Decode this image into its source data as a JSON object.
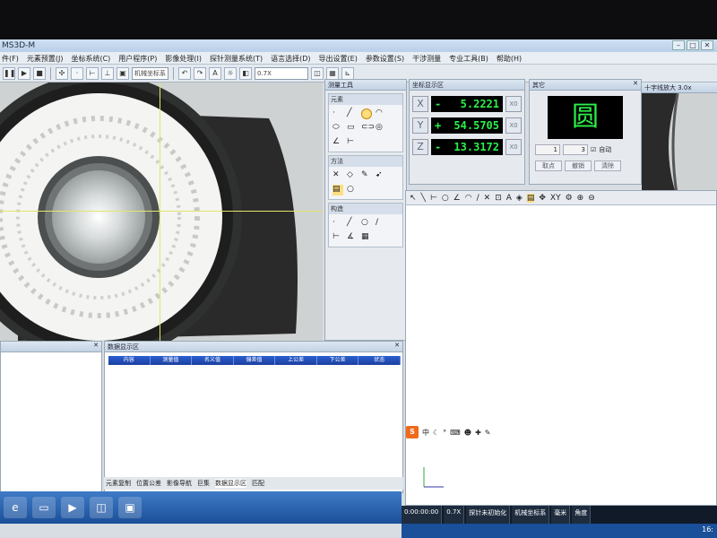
{
  "window": {
    "title": "MS3D-M"
  },
  "menu": [
    "件(F)",
    "元素预置(J)",
    "坐标系统(C)",
    "用户程序(P)",
    "影像处理(I)",
    "探针测量系统(T)",
    "语言选择(D)",
    "导出设置(E)",
    "参数设置(S)",
    "干涉测量",
    "专业工具(B)",
    "帮助(H)"
  ],
  "toolbar": {
    "coord_select": "机械坐标系",
    "zoom_select": "0.7X"
  },
  "tools_panel": {
    "title": "测量工具",
    "groups": [
      "元素",
      "方法",
      "构造"
    ]
  },
  "coords": {
    "title": "坐标显示区",
    "rows": [
      {
        "axis": "X",
        "sign": "-",
        "value": "5.2221"
      },
      {
        "axis": "Y",
        "sign": "+",
        "value": "54.5705"
      },
      {
        "axis": "Z",
        "sign": "-",
        "value": "13.3172"
      }
    ],
    "zero_label": "X0"
  },
  "other_panel": {
    "title": "其它",
    "shape_name": "圆",
    "field1": "1",
    "field2": "3",
    "auto_label": "自动",
    "buttons": [
      "取点",
      "撤销",
      "清除"
    ]
  },
  "right_camera": {
    "title": "十字线放大 3.0x"
  },
  "data_panel": {
    "title": "数据显示区",
    "columns": [
      "内容",
      "测量值",
      "名义值",
      "偏差值",
      "上公差",
      "下公差",
      "状态"
    ]
  },
  "bottom_tabs": [
    "元素复制",
    "位置公差",
    "影像导航",
    "巨集",
    "数据显示区",
    "匹配"
  ],
  "status": {
    "time": "0:00:00:00",
    "zoom": "0.7X",
    "probe": "探针未初始化",
    "coord_system": "机械坐标系",
    "unit": "毫米",
    "angle": "角度"
  },
  "taskbar": {
    "clock": "16:"
  }
}
